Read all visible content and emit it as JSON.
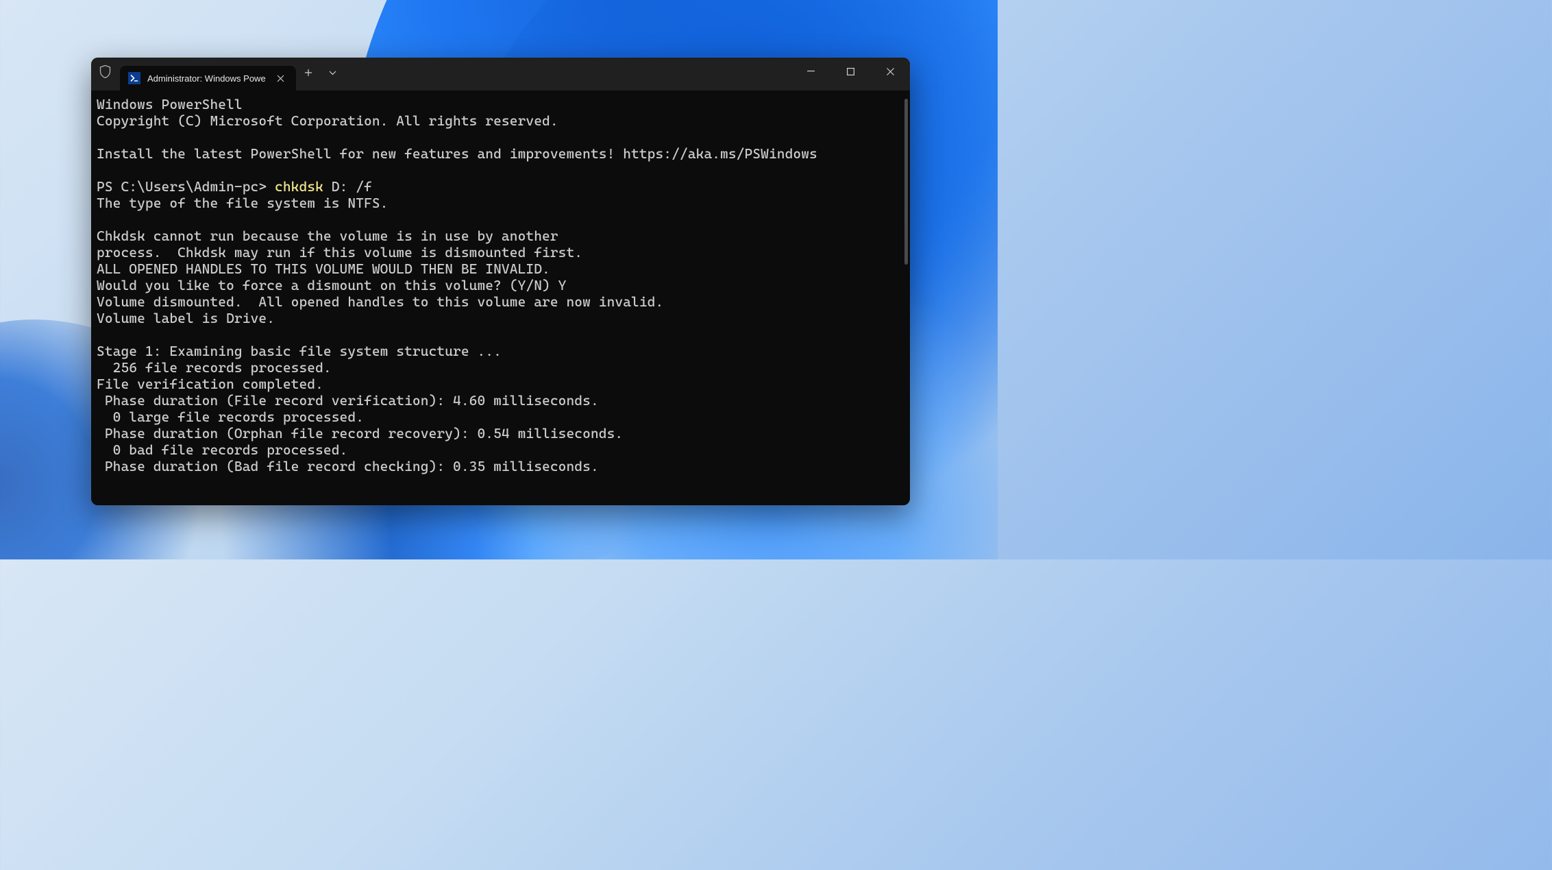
{
  "window": {
    "tab_title": "Administrator: Windows Powe",
    "admin_shield_label": "Admin shield"
  },
  "terminal": {
    "lines": [
      "Windows PowerShell",
      "Copyright (C) Microsoft Corporation. All rights reserved.",
      "",
      "Install the latest PowerShell for new features and improvements! https://aka.ms/PSWindows",
      ""
    ],
    "prompt": "PS C:\\Users\\Admin-pc> ",
    "command": "chkdsk",
    "args": " D: /f",
    "output": [
      "The type of the file system is NTFS.",
      "",
      "Chkdsk cannot run because the volume is in use by another",
      "process.  Chkdsk may run if this volume is dismounted first.",
      "ALL OPENED HANDLES TO THIS VOLUME WOULD THEN BE INVALID.",
      "Would you like to force a dismount on this volume? (Y/N) Y",
      "Volume dismounted.  All opened handles to this volume are now invalid.",
      "Volume label is Drive.",
      "",
      "Stage 1: Examining basic file system structure ...",
      "  256 file records processed.",
      "File verification completed.",
      " Phase duration (File record verification): 4.60 milliseconds.",
      "  0 large file records processed.",
      " Phase duration (Orphan file record recovery): 0.54 milliseconds.",
      "  0 bad file records processed.",
      " Phase duration (Bad file record checking): 0.35 milliseconds."
    ]
  }
}
